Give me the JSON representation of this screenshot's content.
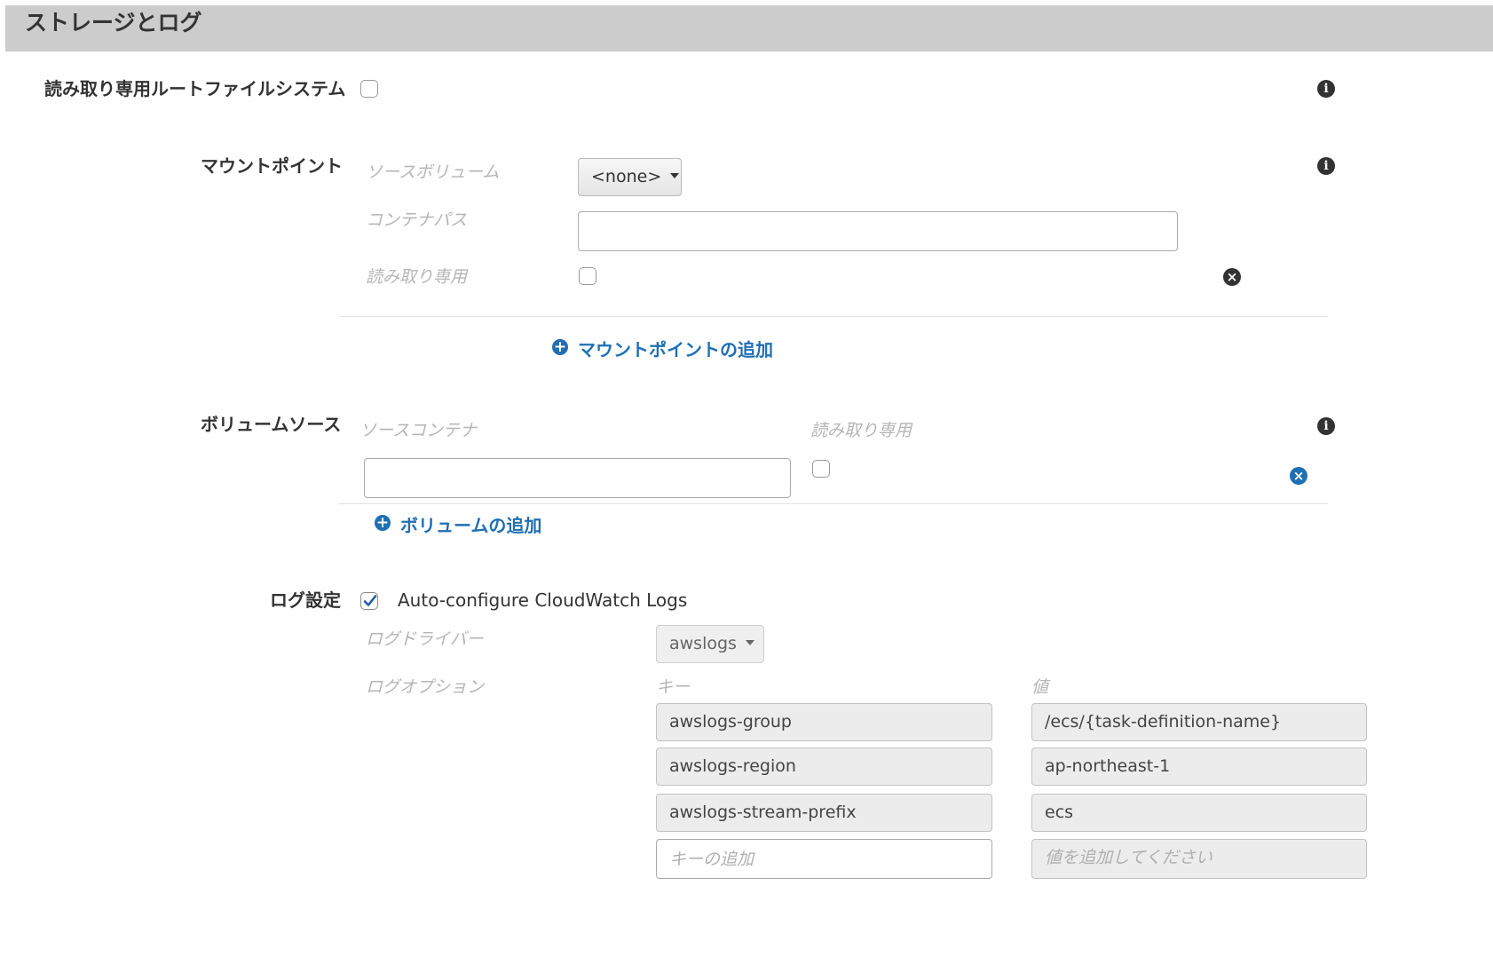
{
  "header": {
    "title": "ストレージとログ"
  },
  "readonly_root": {
    "label": "読み取り専用ルートファイルシステム",
    "checked": false
  },
  "mount_points": {
    "label": "マウントポイント",
    "source_volume_label": "ソースボリューム",
    "source_volume_value": "<none>",
    "container_path_label": "コンテナパス",
    "container_path_value": "",
    "readonly_label": "読み取り専用",
    "add_link": "マウントポイントの追加"
  },
  "volumes_from": {
    "label": "ボリュームソース",
    "source_container_label": "ソースコンテナ",
    "readonly_label": "読み取り専用",
    "source_container_value": "",
    "add_link": "ボリュームの追加"
  },
  "log_config": {
    "label": "ログ設定",
    "auto_configure_label": "Auto-configure CloudWatch Logs",
    "auto_configure_checked": true,
    "driver_label": "ログドライバー",
    "driver_value": "awslogs",
    "options_label": "ログオプション",
    "key_header": "キー",
    "value_header": "値",
    "options": [
      {
        "key": "awslogs-group",
        "value": "/ecs/{task-definition-name}"
      },
      {
        "key": "awslogs-region",
        "value": "ap-northeast-1"
      },
      {
        "key": "awslogs-stream-prefix",
        "value": "ecs"
      }
    ],
    "add_key_placeholder": "キーの追加",
    "add_value_placeholder": "値を追加してください"
  },
  "icons": {
    "info": "info-icon",
    "remove": "remove-icon",
    "add": "plus-circle-icon",
    "check": "checkmark-icon"
  },
  "colors": {
    "header_bg": "#cccccc",
    "link": "#1f6fb5"
  }
}
